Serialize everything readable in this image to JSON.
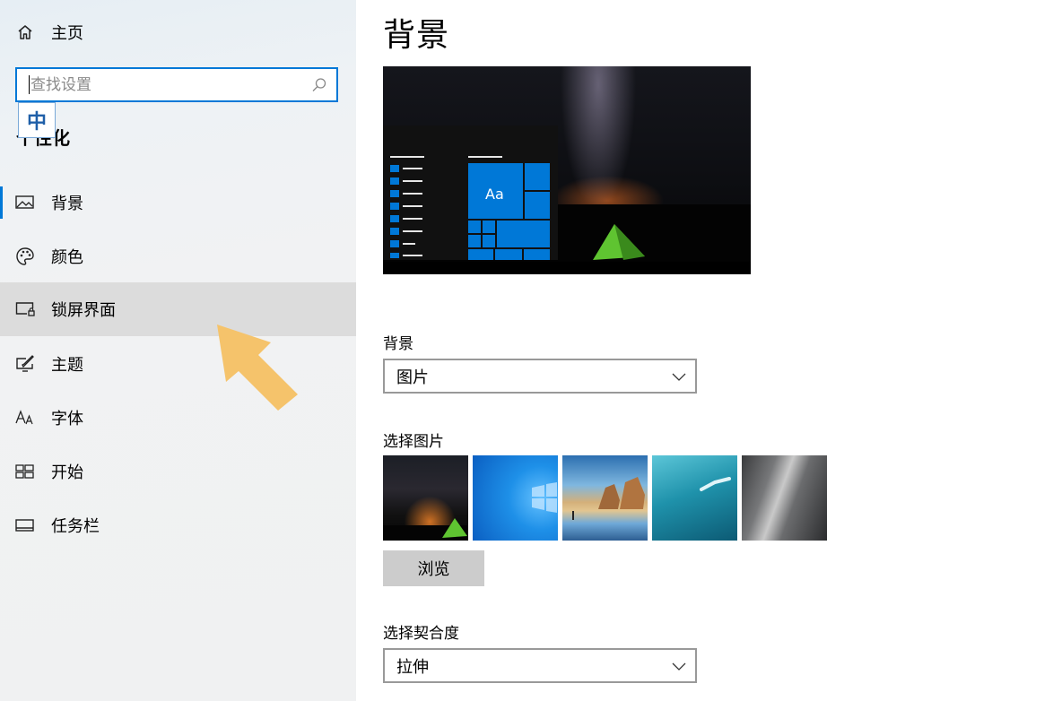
{
  "sidebar": {
    "home_label": "主页",
    "search_placeholder": "查找设置",
    "ime_indicator": "中",
    "section_title": "个性化",
    "items": [
      {
        "label": "背景"
      },
      {
        "label": "颜色"
      },
      {
        "label": "锁屏界面"
      },
      {
        "label": "主题"
      },
      {
        "label": "字体"
      },
      {
        "label": "开始"
      },
      {
        "label": "任务栏"
      }
    ]
  },
  "main": {
    "title": "背景",
    "preview": {
      "tile_text": "Aa"
    },
    "background_label": "背景",
    "background_value": "图片",
    "choose_picture_label": "选择图片",
    "browse_label": "浏览",
    "fit_label": "选择契合度",
    "fit_value": "拉伸"
  },
  "colors": {
    "accent": "#0078d7",
    "arrow": "#f5c36b",
    "hover_bg": "#dcdcdc"
  }
}
